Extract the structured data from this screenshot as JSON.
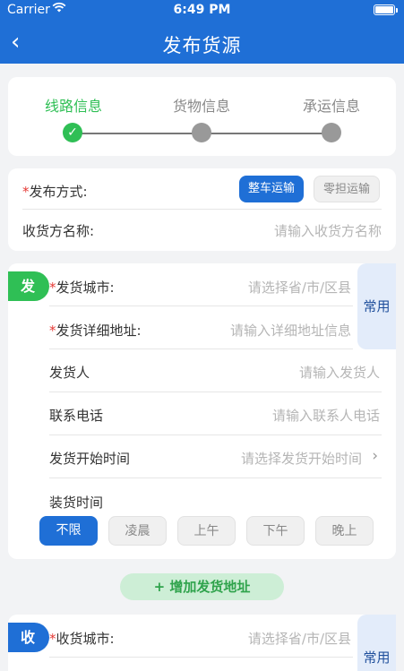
{
  "status_bar": {
    "carrier": "Carrier",
    "time": "6:49 PM"
  },
  "nav": {
    "back_icon": "‹",
    "title": "发布货源"
  },
  "steps": [
    {
      "label": "线路信息",
      "state": "done"
    },
    {
      "label": "货物信息",
      "state": "pending"
    },
    {
      "label": "承运信息",
      "state": "pending"
    }
  ],
  "publish": {
    "required_mark": "*",
    "method_label": "发布方式:",
    "method_options": [
      "整车运输",
      "零担运输"
    ],
    "method_selected": "整车运输",
    "receiver_name_label": "收货方名称:",
    "receiver_name_placeholder": "请输入收货方名称"
  },
  "shipper": {
    "tag": "发",
    "common_button": "常用",
    "city_label": "发货城市:",
    "city_placeholder": "请选择省/市/区县",
    "address_label": "发货详细地址:",
    "address_placeholder": "请输入详细地址信息",
    "person_label": "发货人",
    "person_placeholder": "请输入发货人",
    "phone_label": "联系电话",
    "phone_placeholder": "请输入联系人电话",
    "start_time_label": "发货开始时间",
    "start_time_placeholder": "请选择发货开始时间",
    "loading_time_label": "装货时间",
    "loading_options": [
      "不限",
      "凌晨",
      "上午",
      "下午",
      "晚上"
    ],
    "loading_selected": "不限"
  },
  "add_address_button": "+ 增加发货地址",
  "receiver": {
    "tag": "收",
    "common_button": "常用",
    "city_label": "收货城市:",
    "city_placeholder": "请选择省/市/区县"
  },
  "colors": {
    "primary": "#1f6fd6",
    "success": "#2fbf55",
    "required": "#e53935"
  }
}
